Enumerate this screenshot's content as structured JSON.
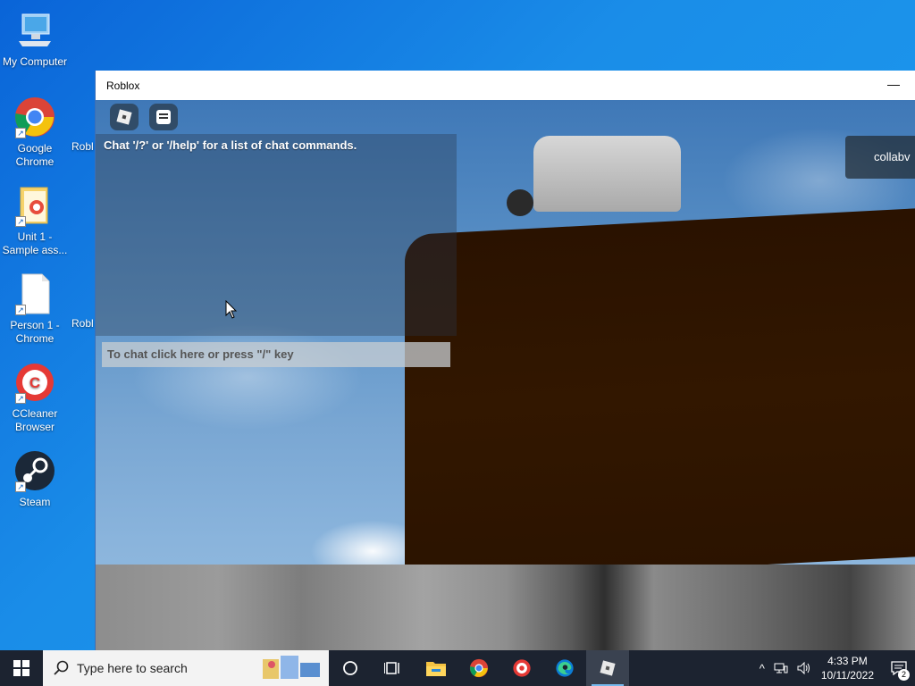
{
  "desktop": {
    "icons": [
      {
        "label": "My Computer"
      },
      {
        "label": "Google Chrome"
      },
      {
        "label": "Unit 1 - Sample ass..."
      },
      {
        "label": "Person 1 - Chrome"
      },
      {
        "label": "CCleaner Browser"
      },
      {
        "label": "Steam"
      }
    ],
    "partial_labels": [
      "Robl",
      "Robl"
    ]
  },
  "window": {
    "title": "Roblox",
    "minimize_glyph": "—"
  },
  "game": {
    "chat_system_message": "Chat '/?' or '/help' for a list of chat commands.",
    "chat_input_placeholder": "To chat click here or press \"/\" key",
    "player_name_partial": "collabv"
  },
  "taskbar": {
    "search_placeholder": "Type here to search",
    "time": "4:33 PM",
    "date": "10/11/2022",
    "notification_count": "2",
    "pinned": [
      "cortana-icon",
      "task-view-icon",
      "file-explorer-icon",
      "chrome-icon",
      "ccleaner-icon",
      "edge-icon",
      "roblox-icon"
    ]
  },
  "colors": {
    "desktop_blue": "#1a8de8",
    "taskbar": "#1c2330",
    "chat_panel": "#28374b"
  }
}
